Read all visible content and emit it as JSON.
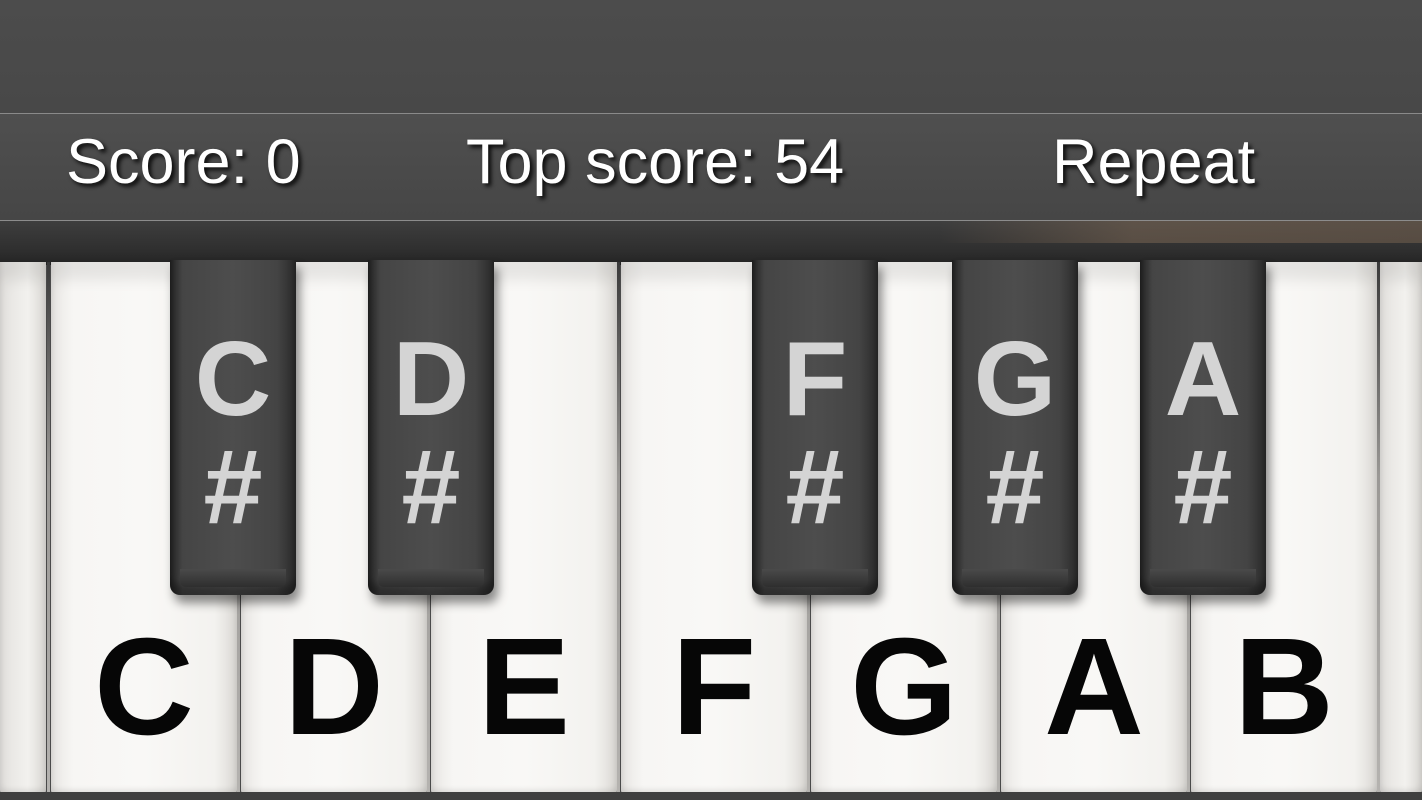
{
  "hud": {
    "score_text": "Score: 0",
    "top_score_text": "Top score: 54",
    "repeat_label": "Repeat"
  },
  "keyboard": {
    "white_keys": [
      "C",
      "D",
      "E",
      "F",
      "G",
      "A",
      "B"
    ],
    "black_keys": [
      {
        "letter": "C",
        "sharp": "#"
      },
      {
        "letter": "D",
        "sharp": "#"
      },
      {
        "letter": "F",
        "sharp": "#"
      },
      {
        "letter": "G",
        "sharp": "#"
      },
      {
        "letter": "A",
        "sharp": "#"
      }
    ]
  },
  "colors": {
    "background": "#4a4a4a",
    "white_key": "#f8f7f5",
    "black_key": "#474747",
    "white_label": "#060606",
    "black_label": "#d4d4d4",
    "hud_text": "#ffffff"
  }
}
